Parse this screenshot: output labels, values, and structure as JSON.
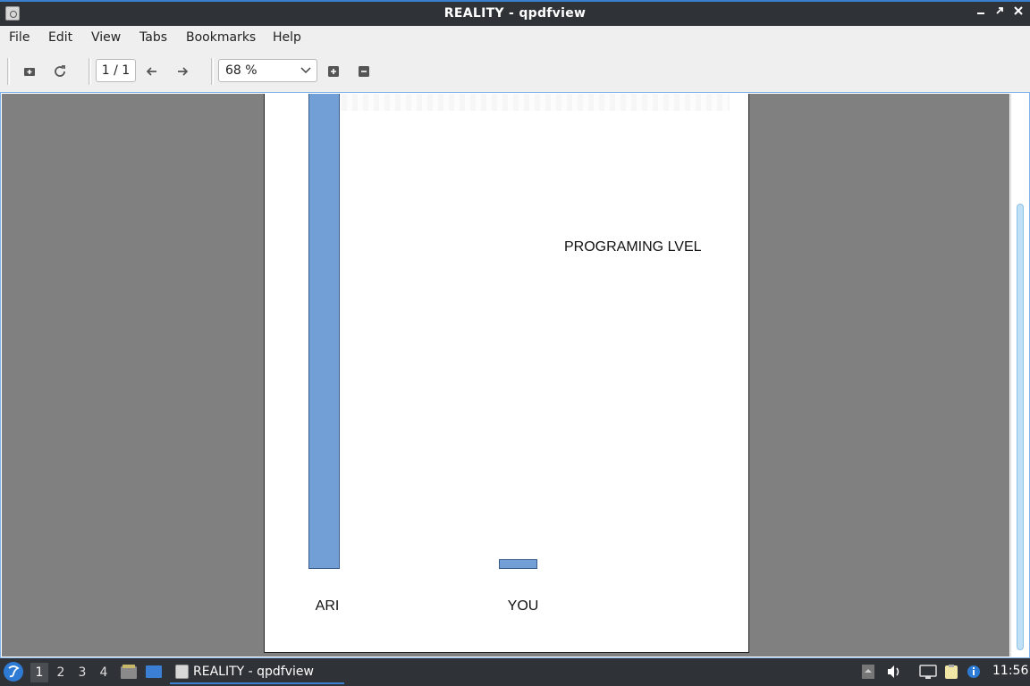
{
  "window": {
    "title": "REALITY - qpdfview"
  },
  "menubar": {
    "items": [
      "File",
      "Edit",
      "View",
      "Tabs",
      "Bookmarks",
      "Help"
    ]
  },
  "toolbar": {
    "page_indicator": "1 / 1",
    "zoom_value": "68 %"
  },
  "document": {
    "heading": "PROGRAMING LVEL",
    "chart_data": {
      "type": "bar",
      "categories": [
        "ARI",
        "YOU"
      ],
      "values": [
        100,
        2
      ],
      "bar_color": "#729fd5",
      "title": "PROGRAMING LVEL"
    }
  },
  "taskbar": {
    "workspaces": [
      "1",
      "2",
      "3",
      "4"
    ],
    "active_workspace": "1",
    "task_label": "REALITY - qpdfview",
    "clock": "11:56"
  },
  "colors": {
    "accent": "#3a7fd0",
    "titlebar": "#2f3237",
    "canvas": "#808080"
  }
}
